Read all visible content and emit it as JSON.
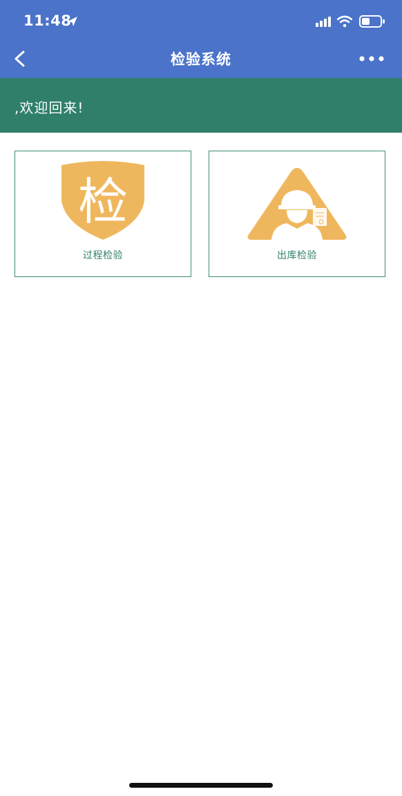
{
  "status_bar": {
    "time": "11:48"
  },
  "nav": {
    "title": "检验系统"
  },
  "banner": {
    "welcome_text": ",欢迎回来!"
  },
  "tiles": [
    {
      "label": "过程检验",
      "icon": "shield-inspection-icon",
      "icon_glyph": "检"
    },
    {
      "label": "出库检验",
      "icon": "worker-warning-icon"
    }
  ],
  "colors": {
    "header": "#4a73c9",
    "banner": "#2f7f6a",
    "tile_border": "#3d8a78",
    "icon_fill": "#efb75d"
  }
}
